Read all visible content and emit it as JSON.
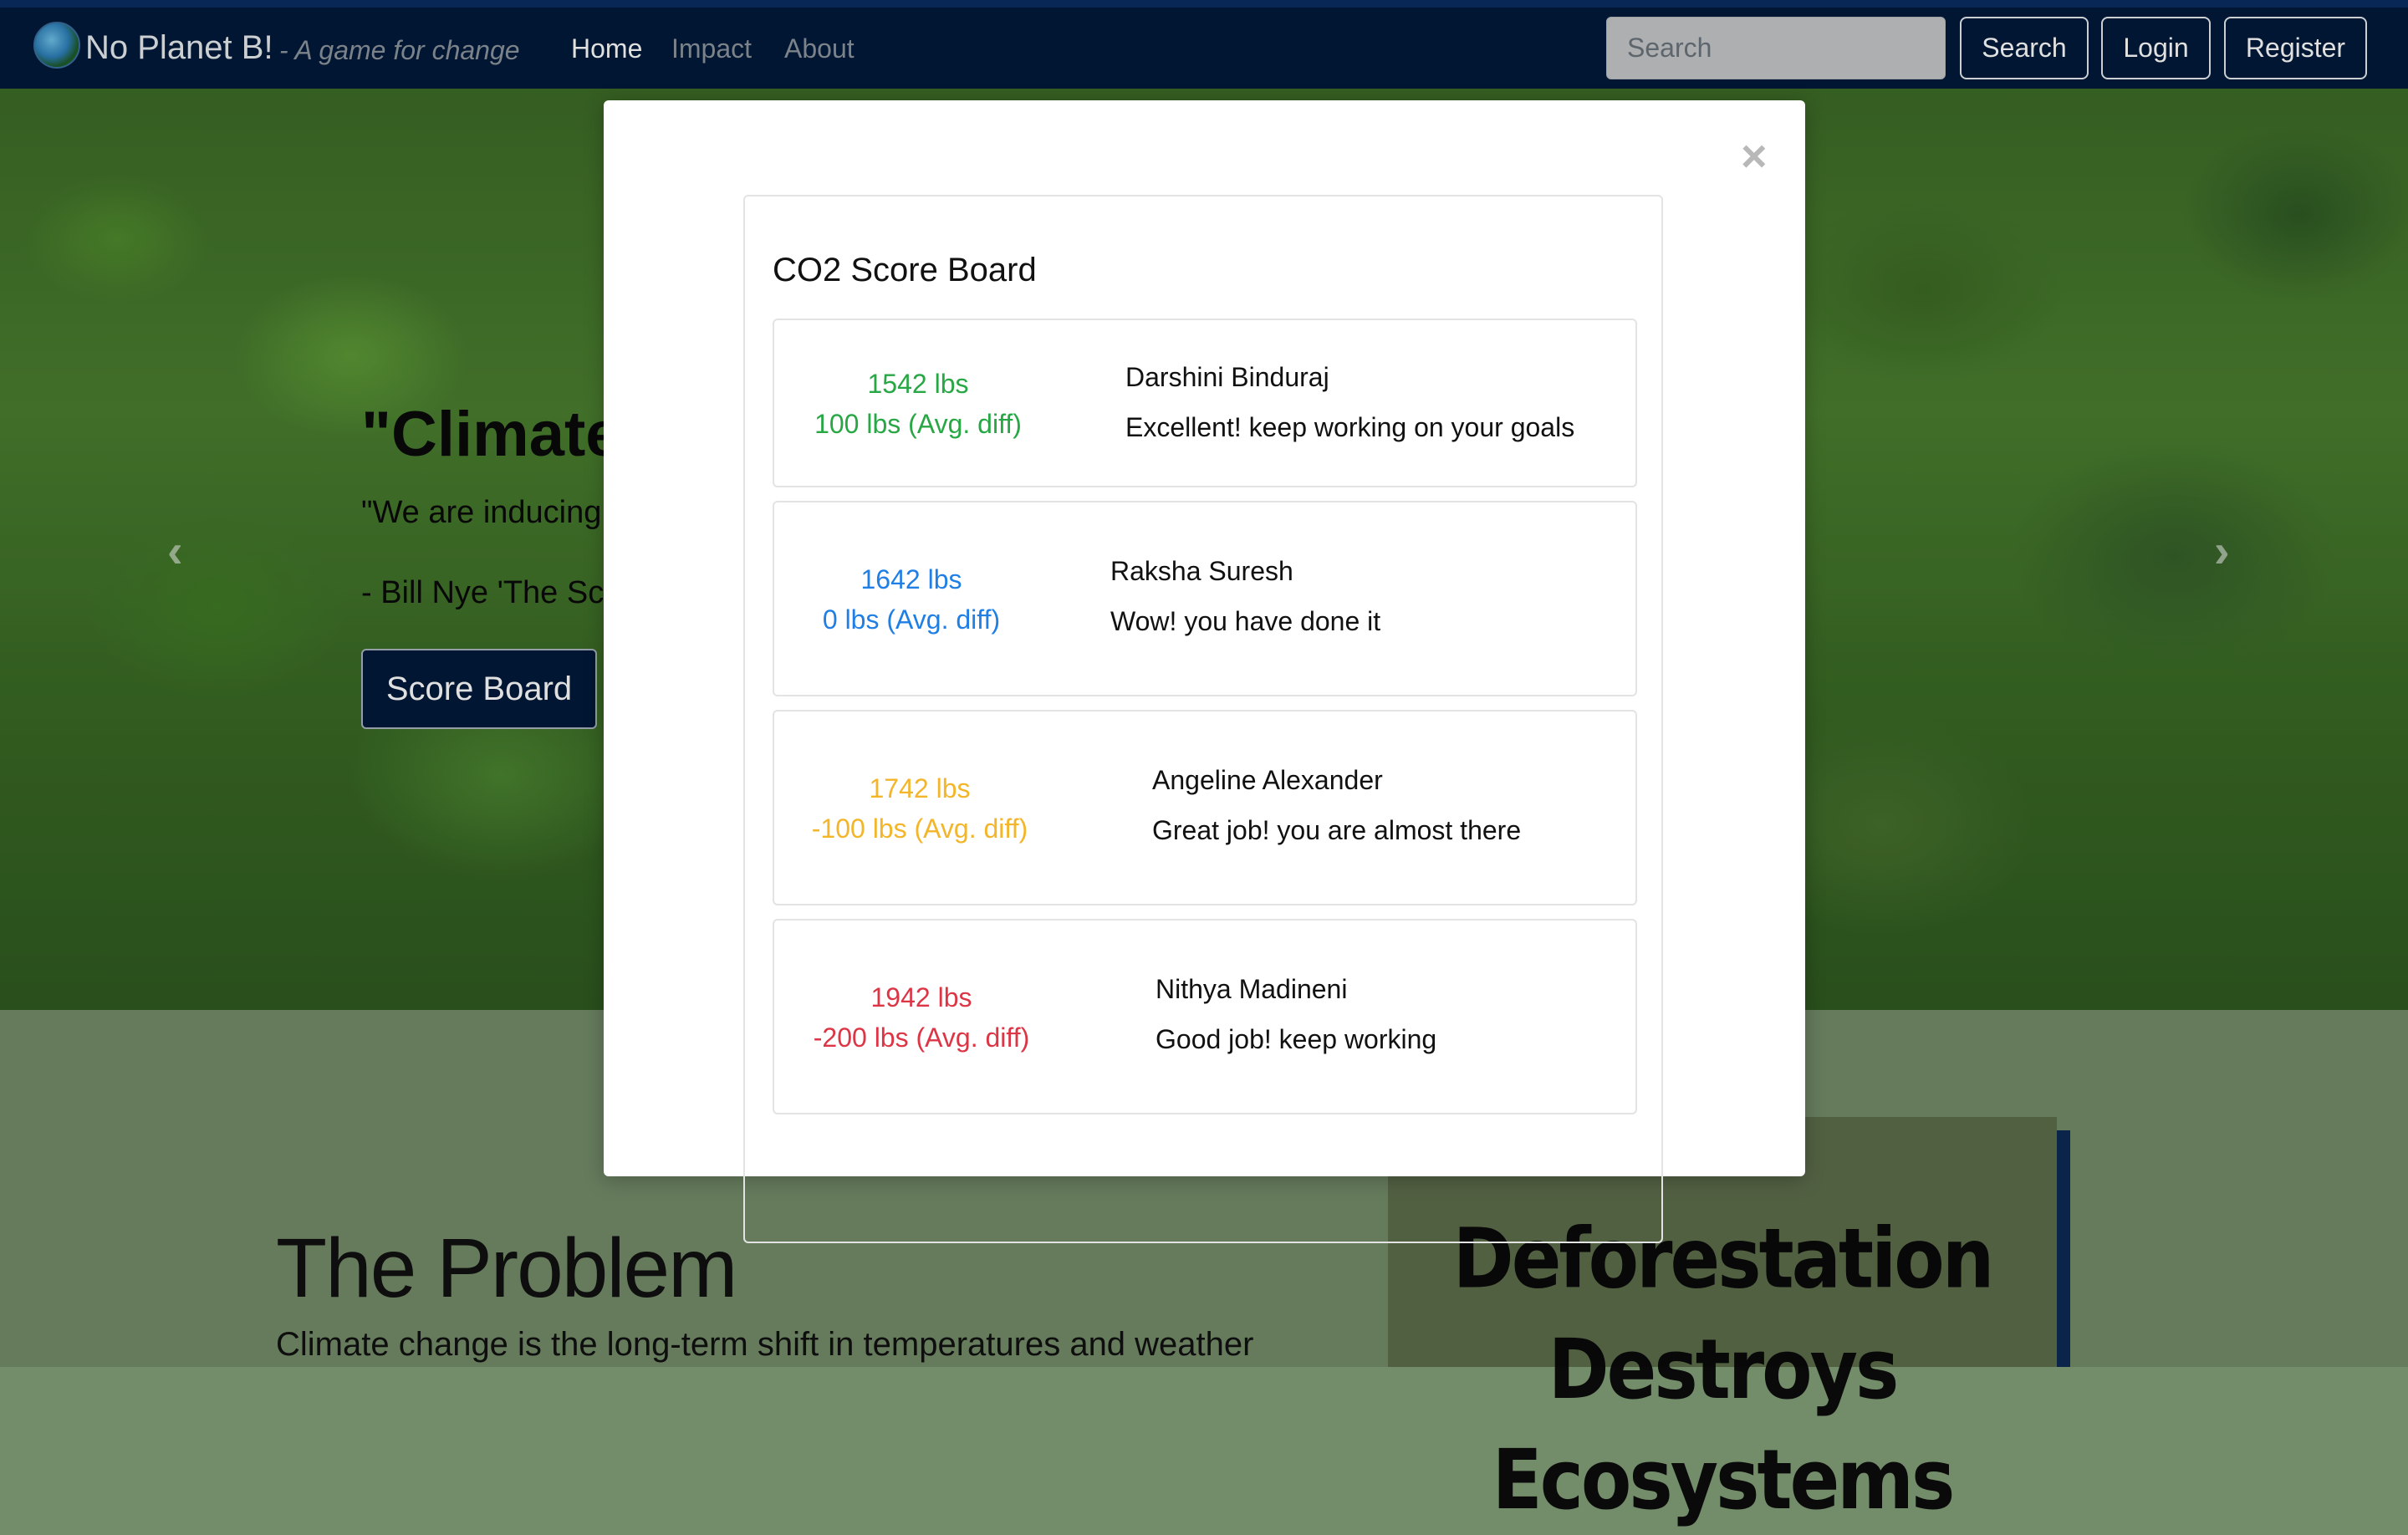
{
  "navbar": {
    "brand_name": "No Planet B!",
    "brand_tagline": "- A game for change",
    "links": [
      "Home",
      "Impact",
      "About"
    ],
    "search_placeholder": "Search",
    "search_button": "Search",
    "login_button": "Login",
    "register_button": "Register"
  },
  "hero": {
    "title": "\"Climate Change is a Matter of Science\"",
    "quote": "\"We are inducing climate change. We may be the first species to make ourselves extinctee.\"",
    "attribution": "- Bill Nye 'The Science Guy'",
    "score_board_button": "Score Board",
    "prev_arrow": "‹",
    "next_arrow": "›"
  },
  "modal": {
    "close_glyph": "×",
    "board_title": "CO2 Score Board",
    "entries": [
      {
        "score": "1542 lbs",
        "diff": "100 lbs (Avg. diff)",
        "name": "Darshini Binduraj",
        "message": "Excellent! keep working on your goals",
        "color": "#28a745"
      },
      {
        "score": "1642 lbs",
        "diff": "0 lbs (Avg. diff)",
        "name": "Raksha Suresh",
        "message": "Wow! you have done it",
        "color": "#1f7fe5"
      },
      {
        "score": "1742 lbs",
        "diff": "-100 lbs (Avg. diff)",
        "name": "Angeline Alexander",
        "message": "Great job! you are almost there",
        "color": "#f3b52a"
      },
      {
        "score": "1942 lbs",
        "diff": "-200 lbs (Avg. diff)",
        "name": "Nithya Madineni",
        "message": "Good job! keep working",
        "color": "#dc3545"
      }
    ]
  },
  "problem": {
    "title": "The Problem",
    "text": "Climate change is the long-term shift in temperatures and weather"
  },
  "poster": {
    "title": "Deforestation Destroys Ecosystems"
  }
}
